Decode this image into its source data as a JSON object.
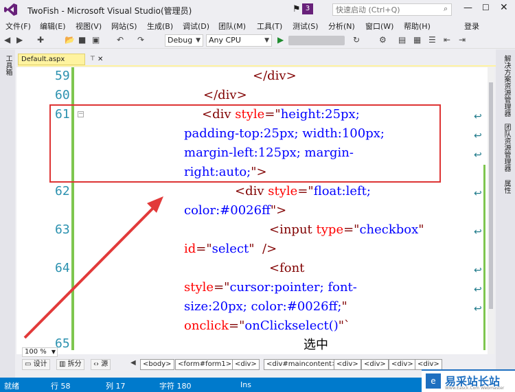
{
  "window": {
    "title": "TwoFish - Microsoft Visual Studio(管理员)",
    "notification_count": "3",
    "quick_launch_placeholder": "快速启动 (Ctrl+Q)",
    "login_label": "登录"
  },
  "menu": [
    "文件(F)",
    "编辑(E)",
    "视图(V)",
    "网站(S)",
    "生成(B)",
    "调试(D)",
    "团队(M)",
    "工具(T)",
    "测试(S)",
    "分析(N)",
    "窗口(W)",
    "帮助(H)"
  ],
  "toolbar": {
    "config_value": "Debug",
    "platform_value": "Any CPU"
  },
  "toolbox_label": "工具箱",
  "right_panels": [
    "解决方案资源管理器",
    "团队资源管理器",
    "属性"
  ],
  "tab": {
    "label": "Default.aspx",
    "pin": "⊤",
    "close": "✕"
  },
  "editor": {
    "lines": [
      {
        "no": "59",
        "code": [
          {
            "c": "tag",
            "t": "</div>"
          }
        ]
      },
      {
        "no": "60",
        "code": [
          {
            "c": "tag",
            "t": "</div>"
          }
        ]
      },
      {
        "no": "61",
        "wrapped": [
          [
            {
              "c": "tag",
              "t": "<div "
            },
            {
              "c": "attr",
              "t": "style"
            },
            {
              "c": "tag",
              "t": "=\""
            },
            {
              "c": "val",
              "t": "height:25px;"
            }
          ],
          [
            {
              "c": "val",
              "t": "padding-top:25px; width:100px;"
            }
          ],
          [
            {
              "c": "val",
              "t": "margin-left:125px; margin-"
            }
          ],
          [
            {
              "c": "val",
              "t": "right:auto;"
            },
            {
              "c": "tag",
              "t": "\">"
            }
          ]
        ]
      },
      {
        "no": "62",
        "wrapped": [
          [
            {
              "c": "tag",
              "t": "<div "
            },
            {
              "c": "attr",
              "t": "style"
            },
            {
              "c": "tag",
              "t": "=\""
            },
            {
              "c": "val",
              "t": "float:left;"
            }
          ],
          [
            {
              "c": "val",
              "t": "color:#0026ff"
            },
            {
              "c": "tag",
              "t": "\">"
            }
          ]
        ]
      },
      {
        "no": "63",
        "wrapped": [
          [
            {
              "c": "tag",
              "t": "<input "
            },
            {
              "c": "attr",
              "t": "type"
            },
            {
              "c": "tag",
              "t": "=\""
            },
            {
              "c": "val",
              "t": "checkbox"
            },
            {
              "c": "tag",
              "t": "\""
            }
          ],
          [
            {
              "c": "attr",
              "t": "id"
            },
            {
              "c": "tag",
              "t": "=\""
            },
            {
              "c": "val",
              "t": "select"
            },
            {
              "c": "tag",
              "t": "\"  />"
            }
          ]
        ]
      },
      {
        "no": "64",
        "wrapped": [
          [
            {
              "c": "tag",
              "t": "<font"
            }
          ],
          [
            {
              "c": "attr",
              "t": "style"
            },
            {
              "c": "tag",
              "t": "=\""
            },
            {
              "c": "val",
              "t": "cursor:pointer; font-"
            }
          ],
          [
            {
              "c": "val",
              "t": "size:20px; color:#0026ff;"
            },
            {
              "c": "tag",
              "t": "\""
            }
          ],
          [
            {
              "c": "attr",
              "t": "onclick"
            },
            {
              "c": "tag",
              "t": "=\""
            },
            {
              "c": "val",
              "t": "onClickselect()"
            },
            {
              "c": "tag",
              "t": "\"`"
            }
          ]
        ]
      },
      {
        "no": "65",
        "code": [
          {
            "c": "txt",
            "t": "选中"
          }
        ]
      }
    ]
  },
  "bottom": {
    "zoom": "100 %",
    "design_label": "设计",
    "split_label": "拆分",
    "source_label": "源",
    "breadcrumbs": [
      "<body>",
      "<form#form1>",
      "<div>",
      "<div#maincontent>",
      "<div>",
      "<div>",
      "<div>",
      "<div>"
    ]
  },
  "status": {
    "ready": "就绪",
    "row": "行 58",
    "col": "列 17",
    "char": "字符 180",
    "mode": "Ins"
  },
  "watermark": {
    "text": "易采站长站",
    "sub": "Www.Easck.Com Webmaster",
    "logo": "e"
  },
  "colors": {
    "accent": "#007acc",
    "annotation": "#dd3333",
    "tag": "#800000",
    "attr": "#ff0000",
    "value": "#0000ff"
  }
}
